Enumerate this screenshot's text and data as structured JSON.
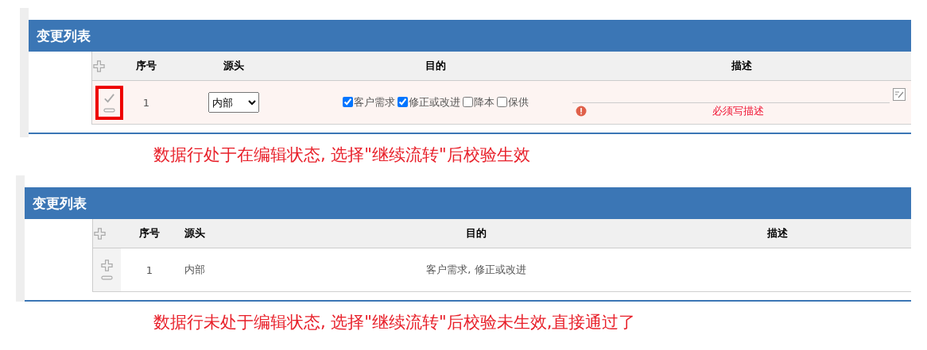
{
  "panels": [
    {
      "title": "变更列表",
      "columns": [
        "序号",
        "源头",
        "目的",
        "描述"
      ],
      "row": {
        "kind": "edit",
        "highlighted": true,
        "index": "1",
        "source": "内部",
        "purposes": [
          {
            "label": "客户需求",
            "checked": true
          },
          {
            "label": "修正或改进",
            "checked": true
          },
          {
            "label": "降本",
            "checked": false
          },
          {
            "label": "保供",
            "checked": false
          }
        ],
        "error": "必须写描述"
      },
      "caption": "数据行处于在编辑状态, 选择\"继续流转\"后校验生效"
    },
    {
      "title": "变更列表",
      "columns": [
        "序号",
        "源头",
        "目的",
        "描述"
      ],
      "row": {
        "kind": "view",
        "highlighted": false,
        "index": "1",
        "source": "内部",
        "purpose_text": "客户需求, 修正或改进"
      },
      "caption": "数据行未处于编辑状态, 选择\"继续流转\"后校验未生效,直接通过了"
    }
  ]
}
